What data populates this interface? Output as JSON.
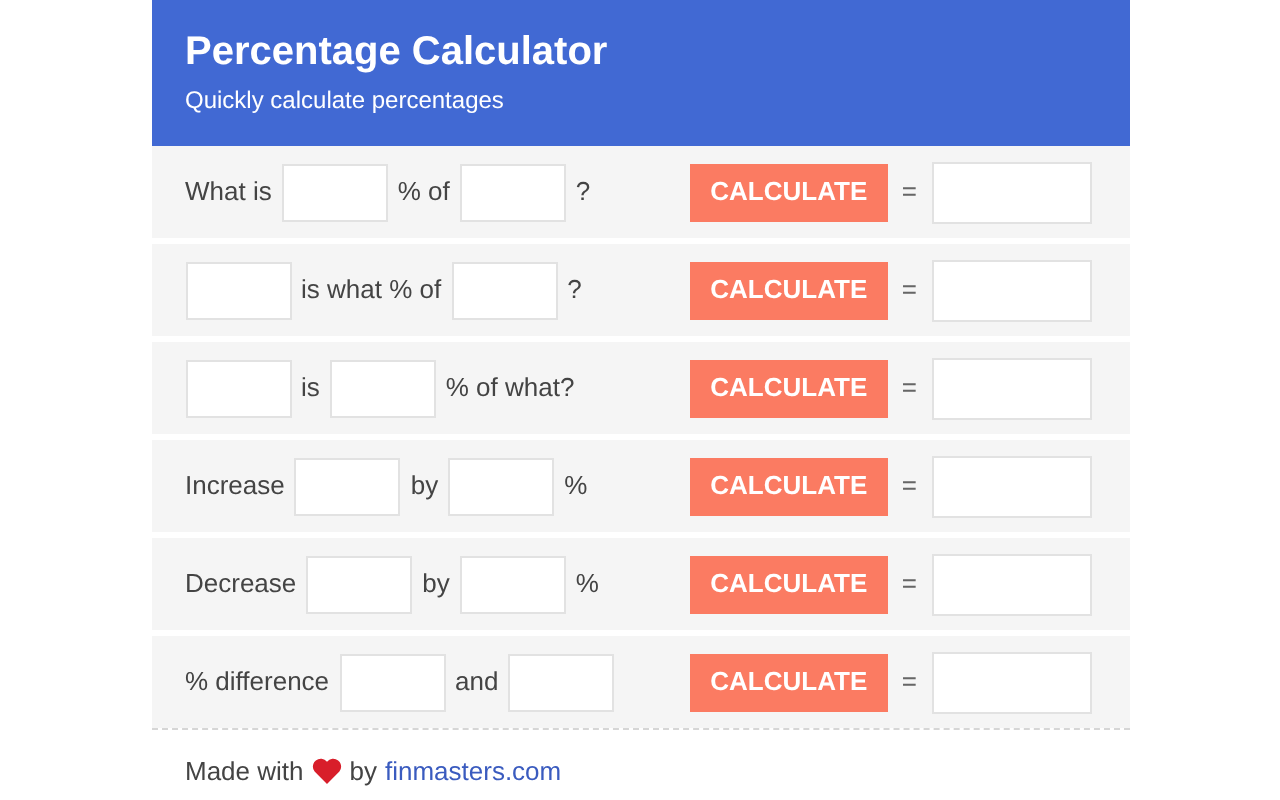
{
  "header": {
    "title": "Percentage Calculator",
    "subtitle": "Quickly calculate percentages"
  },
  "rows": [
    {
      "parts": [
        {
          "kind": "text",
          "text": "What is"
        },
        {
          "kind": "input"
        },
        {
          "kind": "text",
          "text": "% of"
        },
        {
          "kind": "input"
        },
        {
          "kind": "text",
          "text": "?"
        }
      ],
      "button": "CALCULATE",
      "equals": "="
    },
    {
      "parts": [
        {
          "kind": "input"
        },
        {
          "kind": "text",
          "text": "is what % of"
        },
        {
          "kind": "input"
        },
        {
          "kind": "text",
          "text": "?"
        }
      ],
      "button": "CALCULATE",
      "equals": "="
    },
    {
      "parts": [
        {
          "kind": "input"
        },
        {
          "kind": "text",
          "text": "is"
        },
        {
          "kind": "input"
        },
        {
          "kind": "text",
          "text": "% of what?"
        }
      ],
      "button": "CALCULATE",
      "equals": "="
    },
    {
      "parts": [
        {
          "kind": "text",
          "text": "Increase"
        },
        {
          "kind": "input"
        },
        {
          "kind": "text",
          "text": "by"
        },
        {
          "kind": "input"
        },
        {
          "kind": "text",
          "text": "%"
        }
      ],
      "button": "CALCULATE",
      "equals": "="
    },
    {
      "parts": [
        {
          "kind": "text",
          "text": "Decrease"
        },
        {
          "kind": "input"
        },
        {
          "kind": "text",
          "text": "by"
        },
        {
          "kind": "input"
        },
        {
          "kind": "text",
          "text": "%"
        }
      ],
      "button": "CALCULATE",
      "equals": "="
    },
    {
      "parts": [
        {
          "kind": "text",
          "text": "% difference"
        },
        {
          "kind": "input"
        },
        {
          "kind": "text",
          "text": "and"
        },
        {
          "kind": "input"
        }
      ],
      "button": "CALCULATE",
      "equals": "="
    }
  ],
  "footer": {
    "prefix": "Made with",
    "middle": "by",
    "link": "finmasters.com"
  }
}
